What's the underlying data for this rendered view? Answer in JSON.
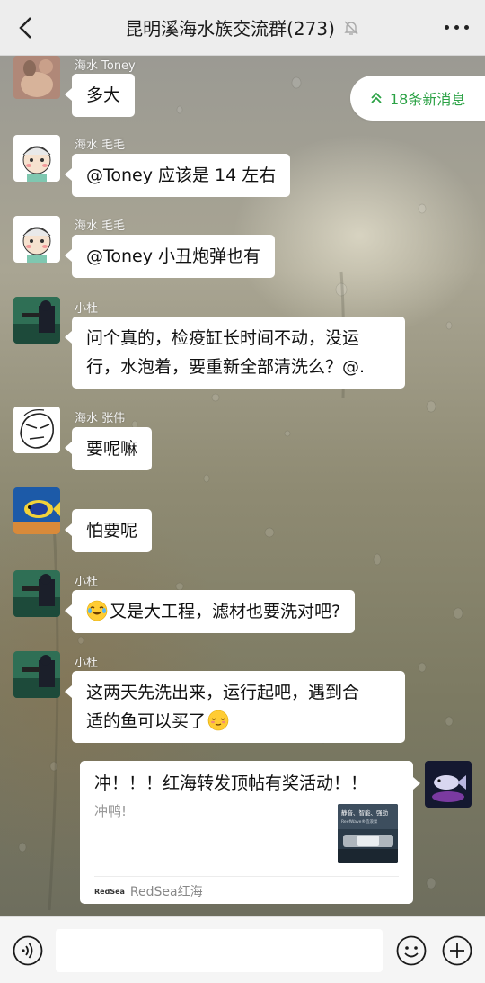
{
  "header": {
    "title": "昆明溪海水族交流群(273)",
    "back_icon": "chevron-left-icon",
    "mute_icon": "bell-off-icon",
    "more_icon": "more-dots-icon"
  },
  "new_messages": {
    "label": "18条新消息",
    "icon": "double-chevron-up-icon",
    "color": "#2ba245"
  },
  "messages": [
    {
      "sender": "海水 Toney",
      "text": "多大"
    },
    {
      "sender": "海水 毛毛",
      "text": "@Toney  应该是 14 左右"
    },
    {
      "sender": "海水 毛毛",
      "text": "@Toney  小丑炮弹也有"
    },
    {
      "sender": "小杜",
      "lines": [
        "问个真的，检疫缸长时间不动，没运",
        "行，水泡着，要重新全部清洗么？@."
      ]
    },
    {
      "sender": "海水 张伟",
      "text": "要呢嘛"
    },
    {
      "sender": "",
      "text": "怕要呢"
    },
    {
      "sender": "小杜",
      "text": "又是大工程，滤材也要洗对吧?",
      "emoji": "crying-laughing-emoji"
    },
    {
      "sender": "小杜",
      "lines": [
        "这两天先洗出来，运行起吧，遇到合",
        "适的鱼可以买了"
      ],
      "emoji": "relieved-face-emoji"
    }
  ],
  "link_card": {
    "title": "冲！！！红海转发顶帖有奖活动！！",
    "description": "冲鸭!",
    "thumb_text_1": "静音、智能、强劲",
    "thumb_text_2": "ReefWave®造浪泵",
    "source_logo": "RedSea",
    "source_name": "RedSea红海"
  },
  "input_bar": {
    "voice_icon": "voice-icon",
    "emoji_icon": "emoji-face-icon",
    "plus_icon": "plus-circle-icon",
    "input_value": ""
  }
}
